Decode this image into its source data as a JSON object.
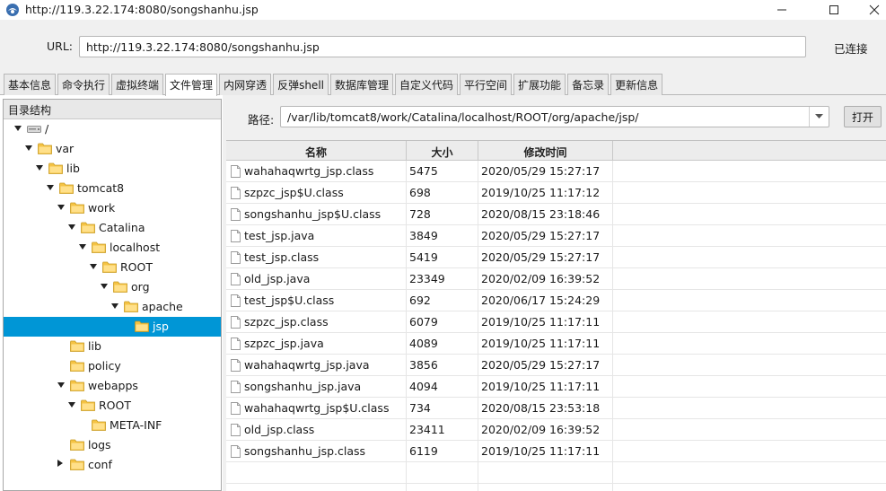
{
  "window": {
    "title": "http://119.3.22.174:8080/songshanhu.jsp"
  },
  "urlbar": {
    "label": "URL:",
    "value": "http://119.3.22.174:8080/songshanhu.jsp",
    "status": "已连接"
  },
  "tabs": [
    {
      "label": "基本信息"
    },
    {
      "label": "命令执行"
    },
    {
      "label": "虚拟终端"
    },
    {
      "label": "文件管理",
      "active": true
    },
    {
      "label": "内网穿透"
    },
    {
      "label": "反弹shell"
    },
    {
      "label": "数据库管理"
    },
    {
      "label": "自定义代码"
    },
    {
      "label": "平行空间"
    },
    {
      "label": "扩展功能"
    },
    {
      "label": "备忘录"
    },
    {
      "label": "更新信息"
    }
  ],
  "tree": {
    "header": "目录结构",
    "items": [
      {
        "label": "/",
        "depth": 0,
        "state": "open",
        "icon": "drive-icon"
      },
      {
        "label": "var",
        "depth": 1,
        "state": "open",
        "icon": "folder-icon"
      },
      {
        "label": "lib",
        "depth": 2,
        "state": "open",
        "icon": "folder-icon"
      },
      {
        "label": "tomcat8",
        "depth": 3,
        "state": "open",
        "icon": "folder-icon"
      },
      {
        "label": "work",
        "depth": 4,
        "state": "open",
        "icon": "folder-icon"
      },
      {
        "label": "Catalina",
        "depth": 5,
        "state": "open",
        "icon": "folder-icon"
      },
      {
        "label": "localhost",
        "depth": 6,
        "state": "open",
        "icon": "folder-icon"
      },
      {
        "label": "ROOT",
        "depth": 7,
        "state": "open",
        "icon": "folder-icon"
      },
      {
        "label": "org",
        "depth": 8,
        "state": "open",
        "icon": "folder-icon"
      },
      {
        "label": "apache",
        "depth": 9,
        "state": "open",
        "icon": "folder-icon"
      },
      {
        "label": "jsp",
        "depth": 10,
        "state": "leaf",
        "icon": "folder-icon",
        "selected": true
      },
      {
        "label": "lib",
        "depth": 4,
        "state": "leaf",
        "icon": "folder-icon"
      },
      {
        "label": "policy",
        "depth": 4,
        "state": "leaf",
        "icon": "folder-icon"
      },
      {
        "label": "webapps",
        "depth": 4,
        "state": "open",
        "icon": "folder-icon"
      },
      {
        "label": "ROOT",
        "depth": 5,
        "state": "open",
        "icon": "folder-icon"
      },
      {
        "label": "META-INF",
        "depth": 6,
        "state": "leaf",
        "icon": "folder-icon"
      },
      {
        "label": "logs",
        "depth": 4,
        "state": "leaf",
        "icon": "folder-icon"
      },
      {
        "label": "conf",
        "depth": 4,
        "state": "closed",
        "icon": "folder-icon"
      }
    ]
  },
  "path": {
    "label": "路径:",
    "value": "/var/lib/tomcat8/work/Catalina/localhost/ROOT/org/apache/jsp/",
    "open_label": "打开"
  },
  "table": {
    "headers": {
      "name": "名称",
      "size": "大小",
      "modified": "修改时间"
    },
    "rows": [
      {
        "name": "wahahaqwrtg_jsp.class",
        "size": "5475",
        "modified": "2020/05/29 15:27:17"
      },
      {
        "name": "szpzc_jsp$U.class",
        "size": "698",
        "modified": "2019/10/25 11:17:12"
      },
      {
        "name": "songshanhu_jsp$U.class",
        "size": "728",
        "modified": "2020/08/15 23:18:46"
      },
      {
        "name": "test_jsp.java",
        "size": "3849",
        "modified": "2020/05/29 15:27:17"
      },
      {
        "name": "test_jsp.class",
        "size": "5419",
        "modified": "2020/05/29 15:27:17"
      },
      {
        "name": "old_jsp.java",
        "size": "23349",
        "modified": "2020/02/09 16:39:52"
      },
      {
        "name": "test_jsp$U.class",
        "size": "692",
        "modified": "2020/06/17 15:24:29"
      },
      {
        "name": "szpzc_jsp.class",
        "size": "6079",
        "modified": "2019/10/25 11:17:11"
      },
      {
        "name": "szpzc_jsp.java",
        "size": "4089",
        "modified": "2019/10/25 11:17:11"
      },
      {
        "name": "wahahaqwrtg_jsp.java",
        "size": "3856",
        "modified": "2020/05/29 15:27:17"
      },
      {
        "name": "songshanhu_jsp.java",
        "size": "4094",
        "modified": "2019/10/25 11:17:11"
      },
      {
        "name": "wahahaqwrtg_jsp$U.class",
        "size": "734",
        "modified": "2020/08/15 23:53:18"
      },
      {
        "name": "old_jsp.class",
        "size": "23411",
        "modified": "2020/02/09 16:39:52"
      },
      {
        "name": "songshanhu_jsp.class",
        "size": "6119",
        "modified": "2019/10/25 11:17:11"
      }
    ]
  },
  "colors": {
    "selection": "#0096d6",
    "folder": "#f5c344"
  }
}
